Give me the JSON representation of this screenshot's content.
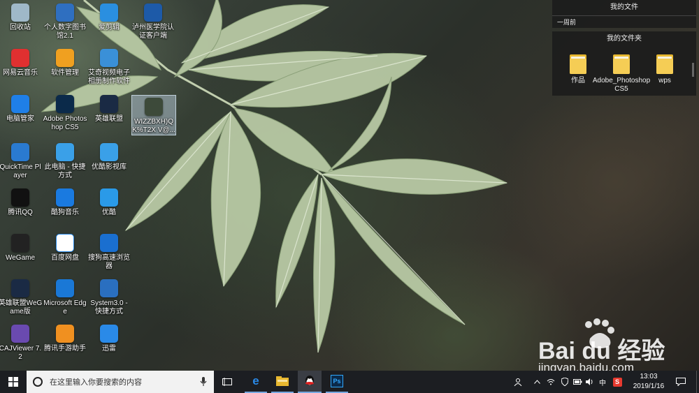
{
  "desktop_icons": [
    {
      "label": "回收站",
      "icon": "recycle-bin-icon",
      "color": "#9fb8c8"
    },
    {
      "label": "个人数字图书馆2.1",
      "icon": "digital-library-icon",
      "color": "#2f6fc0"
    },
    {
      "label": "爱剪辑",
      "icon": "aijianji-icon",
      "color": "#2a8fe0"
    },
    {
      "label": "泸州医学院认证客户端",
      "icon": "auth-client-icon",
      "color": "#1d5aa8"
    },
    {
      "label": "网易云音乐",
      "icon": "netease-music-icon",
      "color": "#e03030"
    },
    {
      "label": "软件管理",
      "icon": "software-manager-icon",
      "color": "#f0a020"
    },
    {
      "label": "艾奇视频电子相册制作软件",
      "icon": "photo-album-icon",
      "color": "#3a90d8"
    },
    {
      "label": "电脑管家",
      "icon": "pc-manager-icon",
      "color": "#1f7fe8"
    },
    {
      "label": "Adobe Photoshop CS5",
      "icon": "photoshop-icon",
      "color": "#0b2a4a"
    },
    {
      "label": "英雄联盟",
      "icon": "league-of-legends-icon",
      "color": "#1a2a44"
    },
    {
      "label": "WIZZBXH)Q K%T2X V@...",
      "icon": "image-file-icon",
      "color": "#3d4a3a"
    },
    {
      "label": "QuickTime Player",
      "icon": "quicktime-icon",
      "color": "#2a7ad0"
    },
    {
      "label": "此电脑 - 快捷方式",
      "icon": "this-pc-icon",
      "color": "#3aa0e8"
    },
    {
      "label": "优酷影视库",
      "icon": "youku-icon",
      "color": "#3aa0e8"
    },
    {
      "label": "腾讯QQ",
      "icon": "qq-icon",
      "color": "#111111"
    },
    {
      "label": "酷狗音乐",
      "icon": "kugou-icon",
      "color": "#1a7ae0"
    },
    {
      "label": "优酷",
      "icon": "youku-app-icon",
      "color": "#2a9ae8"
    },
    {
      "label": "WeGame",
      "icon": "wegame-icon",
      "color": "#222222"
    },
    {
      "label": "百度网盘",
      "icon": "baidu-netdisk-icon",
      "color": "#ffffff"
    },
    {
      "label": "搜狗高速浏览器",
      "icon": "sogou-browser-icon",
      "color": "#1a6fd0"
    },
    {
      "label": "英雄联盟WeGame版",
      "icon": "lol-wegame-icon",
      "color": "#1a2a44"
    },
    {
      "label": "Microsoft Edge",
      "icon": "edge-icon",
      "color": "#1a78d6"
    },
    {
      "label": "System3.0 - 快捷方式",
      "icon": "system3-icon",
      "color": "#2a6fc0"
    },
    {
      "label": "CAJViewer 7.2",
      "icon": "cajviewer-icon",
      "color": "#6a4ab0"
    },
    {
      "label": "腾讯手游助手",
      "icon": "tencent-mobile-assistant-icon",
      "color": "#f09020"
    },
    {
      "label": "迅雷",
      "icon": "xunlei-icon",
      "color": "#2a8ae8"
    }
  ],
  "files_panel": {
    "title": "我的文件",
    "subtitle": "一周前"
  },
  "folders_panel": {
    "title": "我的文件夹",
    "folders": [
      "作品",
      "Adobe_Photoshop CS5",
      "wps"
    ]
  },
  "taskbar": {
    "search_placeholder": "在这里输入你要搜索的内容",
    "apps": [
      "task-view-icon",
      "edge-icon",
      "file-explorer-icon",
      "qq-icon",
      "photoshop-icon"
    ],
    "tray": {
      "ime": "中",
      "time": "13:03",
      "date": "2019/1/16"
    }
  },
  "watermark": {
    "brand": "Bai du 经验",
    "url": "jingyan.baidu.com"
  },
  "colors": {
    "taskbar_bg": "#1c1e22",
    "search_bg": "#f2f2f2",
    "accent": "#1a78d6"
  }
}
